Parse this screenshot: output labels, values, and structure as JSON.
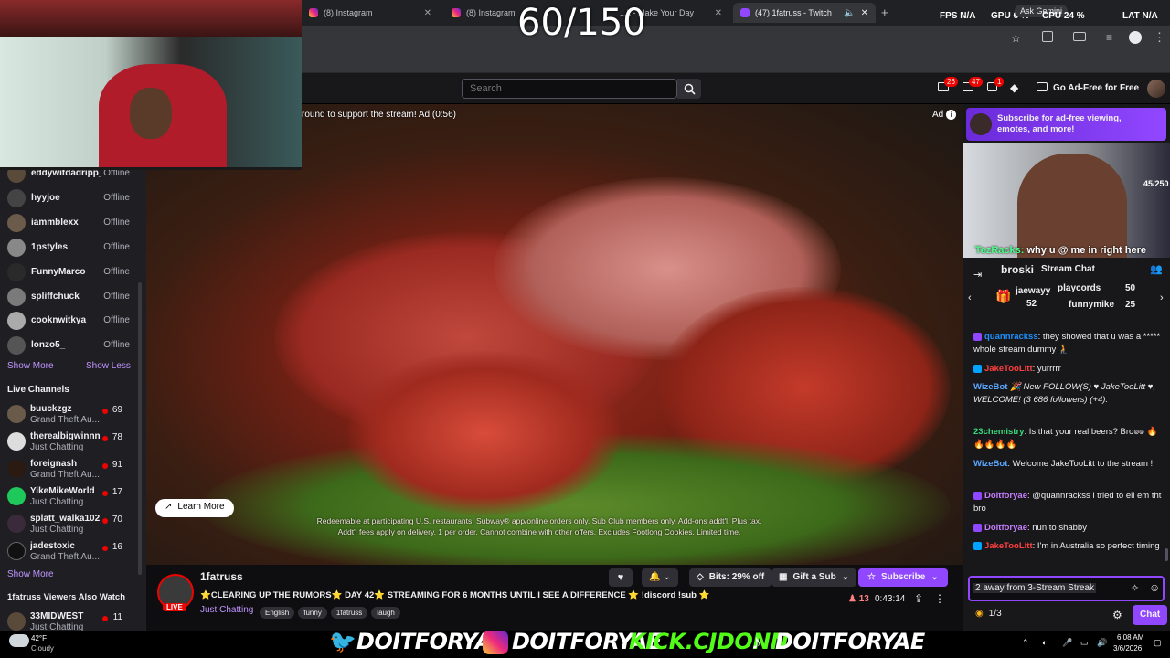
{
  "browser": {
    "tabs": [
      {
        "title": "(8) Instagram"
      },
      {
        "title": "(8) Instagram"
      },
      {
        "title": "...k - Make Your Day"
      },
      {
        "title": "(47) 1fatruss - Twitch"
      }
    ],
    "stats": {
      "fps_label": "FPS",
      "fps_value": "N/A",
      "gpu_label": "GPU",
      "gpu_value": "6 %",
      "cpu_label": "CPU",
      "cpu_value": "24 %",
      "lat_label": "LAT",
      "lat_value": "N/A",
      "gemini": "Ask Gemini"
    },
    "overlay_counter": "60/150"
  },
  "topnav": {
    "search_placeholder": "Search",
    "notifications": {
      "inbox": "26",
      "whispers": "47",
      "alerts": "1"
    },
    "ad_free_label": "Go Ad-Free for Free"
  },
  "sidebar": {
    "followed": [
      {
        "name": "eddywitdadripp_",
        "status": "Offline"
      },
      {
        "name": "hyyjoe",
        "status": "Offline"
      },
      {
        "name": "iammblexx",
        "status": "Offline"
      },
      {
        "name": "1pstyles",
        "status": "Offline"
      },
      {
        "name": "FunnyMarco",
        "status": "Offline"
      },
      {
        "name": "spliffchuck",
        "status": "Offline"
      },
      {
        "name": "cooknwitkya",
        "status": "Offline"
      },
      {
        "name": "lonzo5_",
        "status": "Offline"
      }
    ],
    "show_more": "Show More",
    "show_less": "Show Less",
    "live_heading": "Live Channels",
    "live": [
      {
        "name": "buuckzgz",
        "game": "Grand Theft Au...",
        "viewers": "69"
      },
      {
        "name": "therealbigwinnn",
        "game": "Just Chatting",
        "viewers": "78"
      },
      {
        "name": "foreignash",
        "game": "Grand Theft Au...",
        "viewers": "91"
      },
      {
        "name": "YikeMikeWorld",
        "game": "Just Chatting",
        "viewers": "17"
      },
      {
        "name": "splatt_walka102",
        "game": "Just Chatting",
        "viewers": "70"
      },
      {
        "name": "jadestoxic",
        "game": "Grand Theft Au...",
        "viewers": "16"
      }
    ],
    "show_more_2": "Show More",
    "also_watch_heading": "1fatruss Viewers Also Watch",
    "also_watch": [
      {
        "name": "33MIDWEST",
        "game": "Just Chatting",
        "viewers": "11"
      }
    ]
  },
  "video": {
    "ad_text": "round to support the stream! Ad (0:56)",
    "ad_badge": "Ad",
    "learn_more": "Learn More",
    "disclaimer_1": "Redeemable at participating U.S. restaurants. Subway® app/online orders only. Sub Club members only. Add-ons addt'l. Plus tax.",
    "disclaimer_2": "Addt'l fees apply on delivery. 1 per order. Cannot combine with other offers. Excludes Footlong Cookies. Limited time."
  },
  "stream": {
    "channel": "1fatruss",
    "title": "⭐CLEARING UP THE RUMORS⭐ DAY 42⭐ STREAMING FOR 6 MONTHS UNTIL I SEE A DIFFERENCE ⭐ !discord !sub ⭐",
    "category": "Just Chatting",
    "tags": [
      "English",
      "funny",
      "1fatruss",
      "laugh"
    ],
    "live_label": "LIVE",
    "bits_label": "Bits: 29% off",
    "gift_label": "Gift a Sub",
    "subscribe_label": "Subscribe",
    "viewers": "13",
    "uptime": "0:43:14"
  },
  "chat": {
    "promo": "Subscribe for ad-free viewing, emotes, and more!",
    "cam_counter": "45/250",
    "cam_caption_name": "TezRacks:",
    "cam_caption_text": "why u @ me in right here",
    "header_user": "broski",
    "header_title": "Stream Chat",
    "leaderboard": [
      {
        "name": "jaewayy",
        "value": "52"
      },
      {
        "name": "playcords",
        "value": "50"
      },
      {
        "name": "funnymike",
        "value": "25"
      }
    ],
    "messages": [
      {
        "user": "quannrackss",
        "color": "#1e90ff",
        "text": ": they showed that u was a ***** whole stream dummy 🧎"
      },
      {
        "user": "JakeTooLitt",
        "color": "#ff4040",
        "text": ": yurrrrr"
      },
      {
        "user": "WizeBot",
        "color": "#5aa8ff",
        "text": " 🎉 New FOLLOW(S) ♥ JakeTooLitt ♥, WELCOME! (3 686 followers) (+4)."
      },
      {
        "user": "23chemistry",
        "color": "#38d97a",
        "text": ": Is that your real beers? Bro๏๏ 🔥🔥🔥🔥🔥"
      },
      {
        "user": "WizeBot",
        "color": "#5aa8ff",
        "text": ": Welcome JakeTooLitt to the stream !"
      },
      {
        "user": "Doitforyae",
        "color": "#c77dff",
        "text": ": @quannrackss i tried to ell em tht bro"
      },
      {
        "user": "Doitforyae",
        "color": "#c77dff",
        "text": ": nun to shabby"
      },
      {
        "user": "JakeTooLitt",
        "color": "#ff4040",
        "text": ": I'm in Australia so perfect timing"
      }
    ],
    "input_value": "2 away from 3-Stream Streak",
    "points": "1/3",
    "chat_button": "Chat"
  },
  "taskbar": {
    "temp": "42°F",
    "weather": "Cloudy",
    "time": "6:08 AM",
    "date": "3/6/2026"
  },
  "banner": {
    "twitter": "DOITFORYAE",
    "instagram": "DOITFORYAE",
    "kick": "KICK.CJDONN",
    "tiktok": "DOITFORYAE"
  }
}
